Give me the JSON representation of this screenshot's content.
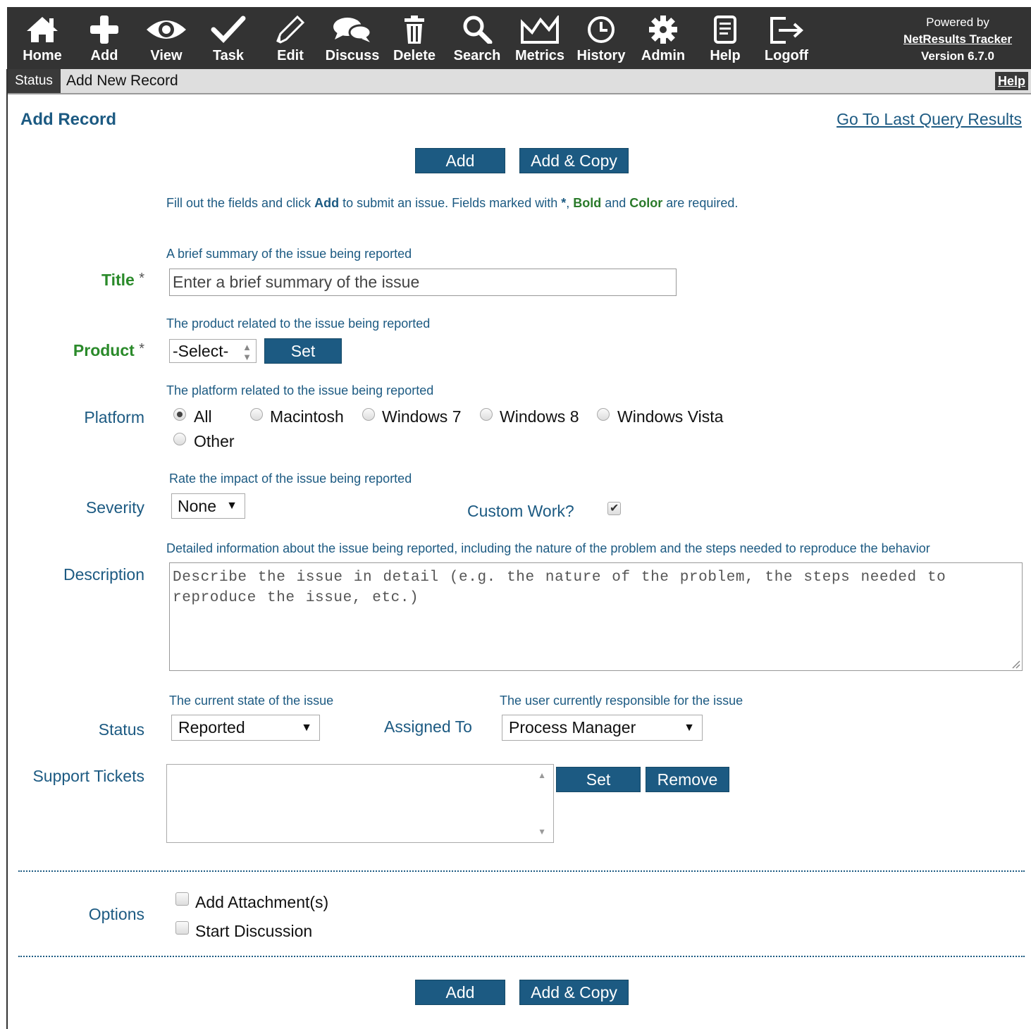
{
  "nav": {
    "items": [
      {
        "label": "Home",
        "icon": "home-icon"
      },
      {
        "label": "Add",
        "icon": "plus-icon"
      },
      {
        "label": "View",
        "icon": "eye-icon"
      },
      {
        "label": "Task",
        "icon": "checkmark-icon"
      },
      {
        "label": "Edit",
        "icon": "pencil-icon"
      },
      {
        "label": "Discuss",
        "icon": "chat-bubbles-icon"
      },
      {
        "label": "Delete",
        "icon": "trash-icon"
      },
      {
        "label": "Search",
        "icon": "magnifier-icon"
      },
      {
        "label": "Metrics",
        "icon": "chart-icon"
      },
      {
        "label": "History",
        "icon": "clock-icon"
      },
      {
        "label": "Admin",
        "icon": "gear-icon"
      },
      {
        "label": "Help",
        "icon": "document-icon"
      },
      {
        "label": "Logoff",
        "icon": "logoff-icon"
      }
    ],
    "powered_by": "Powered by",
    "product_link": "NetResults Tracker",
    "version": "Version 6.7.0"
  },
  "statusbar": {
    "tab": "Status",
    "title": "Add New Record",
    "help": "Help"
  },
  "page": {
    "heading": "Add Record",
    "last_query_link": "Go To Last Query Results"
  },
  "buttons": {
    "add": "Add",
    "add_copy": "Add & Copy",
    "set": "Set",
    "remove": "Remove"
  },
  "intro": {
    "part1": "Fill out the fields and click ",
    "add_word": "Add",
    "part2": " to submit an issue. Fields marked with ",
    "star": "*",
    "comma": ", ",
    "bold_word": "Bold",
    "and": " and ",
    "color_word": "Color",
    "part3": " are required."
  },
  "fields": {
    "title": {
      "label": "Title",
      "star": "*",
      "hint": "A brief summary of the issue being reported",
      "placeholder": "Enter a brief summary of the issue"
    },
    "product": {
      "label": "Product",
      "star": "*",
      "hint": "The product related to the issue being reported",
      "value": "-Select-"
    },
    "platform": {
      "label": "Platform",
      "hint": "The platform related to the issue being reported",
      "options": [
        "All",
        "Macintosh",
        "Windows 7",
        "Windows 8",
        "Windows Vista",
        "Other"
      ],
      "selected": "All"
    },
    "severity": {
      "label": "Severity",
      "hint": "Rate the impact of the issue being reported",
      "value": "None"
    },
    "custom_work": {
      "label": "Custom Work?",
      "checked": true
    },
    "description": {
      "label": "Description",
      "hint": "Detailed information about the issue being reported, including the nature of the problem and the steps needed to reproduce the behavior",
      "placeholder": "Describe the issue in detail (e.g. the nature of the problem, the steps needed to reproduce the issue, etc.)"
    },
    "status": {
      "label": "Status",
      "hint": "The current state of the issue",
      "value": "Reported"
    },
    "assigned_to": {
      "label": "Assigned To",
      "hint": "The user currently responsible for the issue",
      "value": "Process Manager"
    },
    "support_tickets": {
      "label": "Support Tickets"
    }
  },
  "options": {
    "label": "Options",
    "add_attachments": "Add Attachment(s)",
    "start_discussion": "Start Discussion"
  }
}
